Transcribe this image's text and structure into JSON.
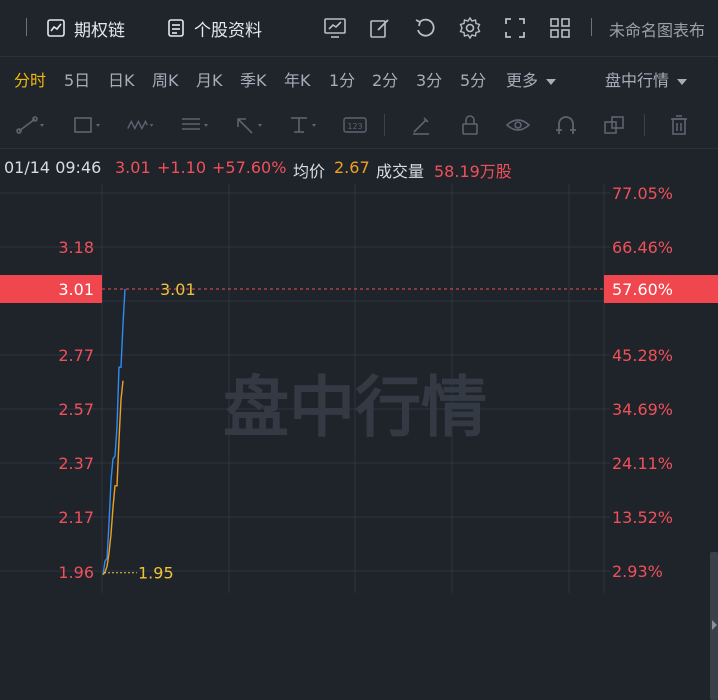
{
  "toolbar": {
    "option_chain_label": "期权链",
    "stock_profile_label": "个股资料",
    "untitled_chart_label": "未命名图表布"
  },
  "periods": {
    "intraday": "分时",
    "d5": "5日",
    "day": "日K",
    "week": "周K",
    "month": "月K",
    "quarter": "季K",
    "year": "年K",
    "m1": "1分",
    "m2": "2分",
    "m3": "3分",
    "m5": "5分",
    "more": "更多",
    "session": "盘中行情"
  },
  "info": {
    "datetime": "01/14 09:46",
    "price": "3.01",
    "change": "+1.10",
    "change_pct": "+57.60%",
    "avg_label": "均价",
    "avg_value": "2.67",
    "volume_label": "成交量",
    "volume_value": "58.19万股"
  },
  "watermark": "盘中行情",
  "colors": {
    "up": "#f0505a",
    "avg": "#f0a021",
    "price_line": "#2f8cf0",
    "accent": "#f0b90b"
  },
  "chart_data": {
    "type": "line",
    "left_axis": [
      "3.18",
      "2.77",
      "2.57",
      "2.37",
      "2.17",
      "1.96"
    ],
    "right_axis": [
      "77.05%",
      "66.46%",
      "45.28%",
      "34.69%",
      "24.11%",
      "13.52%",
      "2.93%"
    ],
    "ylim": [
      1.96,
      3.37
    ],
    "current_price": 3.01,
    "current_price_label": "3.01",
    "current_pct_label": "57.60%",
    "high_annotation": "3.01",
    "low_annotation": "1.95",
    "series": [
      {
        "values": [
          1.95,
          2.0,
          2.01,
          2.14,
          2.3,
          2.38,
          2.39,
          2.5,
          2.72,
          2.72,
          2.88,
          3.01
        ]
      },
      {
        "values": [
          1.95,
          1.96,
          1.98,
          2.03,
          2.1,
          2.2,
          2.28,
          2.28,
          2.45,
          2.6,
          2.67
        ]
      }
    ]
  }
}
